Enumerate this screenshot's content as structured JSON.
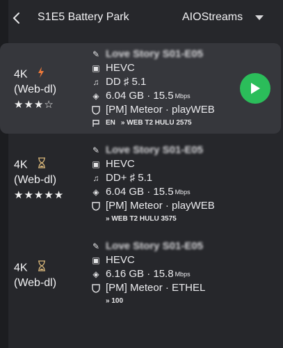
{
  "header": {
    "title": "S1E5 Battery Park",
    "addon": "AIOStreams"
  },
  "streams": [
    {
      "resolution": "4K",
      "source": "(Web-dl)",
      "rating": "★★★☆",
      "status_icon": "lightning-icon",
      "filename": "Love Story S01-E05",
      "codec": "HEVC",
      "audio": "DD ♯ 5.1",
      "size": "6.04 GB · 15.5",
      "size_unit": "Mbps",
      "provider": "[PM] Meteor · playWEB",
      "tags_lang": "EN",
      "tags": "» WEB T2 HULU 2575"
    },
    {
      "resolution": "4K",
      "source": "(Web-dl)",
      "rating": "★★★★★",
      "status_icon": "hourglass-icon",
      "filename": "Love Story S01-E05",
      "codec": "HEVC",
      "audio": "DD+ ♯ 5.1",
      "size": "6.04 GB · 15.5",
      "size_unit": "Mbps",
      "provider": "[PM] Meteor · playWEB",
      "tags": "» WEB T2 HULU 3575"
    },
    {
      "resolution": "4K",
      "source": "(Web-dl)",
      "status_icon": "hourglass-icon",
      "filename": "Love Story S01-E05",
      "codec": "HEVC",
      "size": "6.16 GB · 15.8",
      "size_unit": "Mbps",
      "provider": "[PM] Meteor · ETHEL",
      "tags": "» 100"
    }
  ],
  "colors": {
    "background": "#26272b",
    "selected_card": "#36373c",
    "play_button": "#2bbd5a",
    "lightning": "#f07a3a",
    "hourglass": "#d9b77a"
  }
}
